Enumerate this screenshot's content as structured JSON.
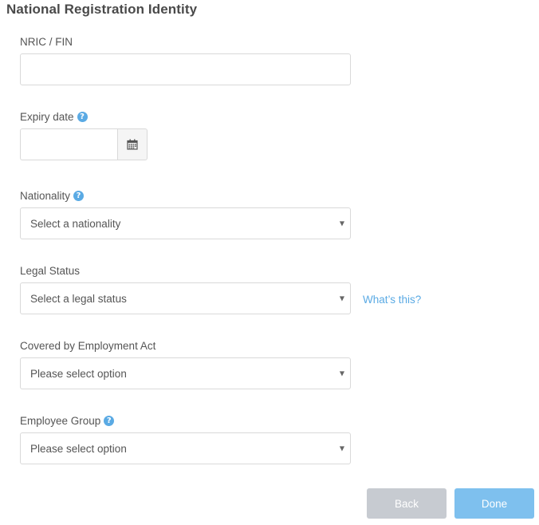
{
  "section": {
    "title": "National Registration Identity"
  },
  "fields": {
    "nric": {
      "label": "NRIC / FIN",
      "value": "",
      "placeholder": ""
    },
    "expiry_date": {
      "label": "Expiry date",
      "value": "",
      "help_icon": "question-circle-icon",
      "addon_icon": "calendar-icon"
    },
    "nationality": {
      "label": "Nationality",
      "selected": "Select a nationality",
      "help_icon": "question-circle-icon"
    },
    "legal_status": {
      "label": "Legal Status",
      "selected": "Select a legal status",
      "link_text": "What’s this?"
    },
    "employment_act": {
      "label": "Covered by Employment Act",
      "selected": "Please select option"
    },
    "employee_group": {
      "label": "Employee Group",
      "selected": "Please select option",
      "help_icon": "question-circle-icon"
    }
  },
  "actions": {
    "back_label": "Back",
    "done_label": "Done"
  },
  "colors": {
    "accent": "#5aaae4",
    "back_button": "#c7cbd1",
    "done_button": "#7ec0ee"
  }
}
